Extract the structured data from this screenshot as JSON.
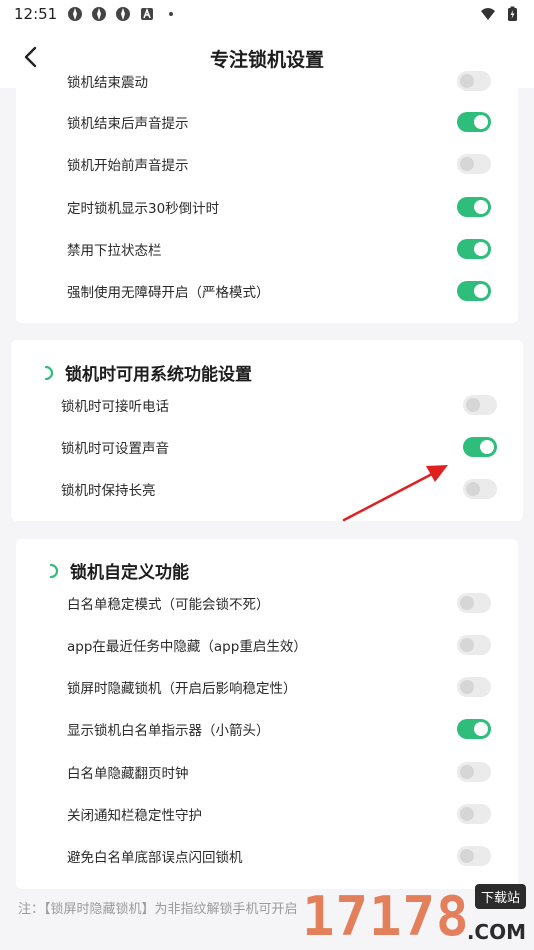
{
  "status_bar": {
    "time": "12:51",
    "left_icons": [
      "app-icon-1",
      "app-icon-2",
      "app-icon-3",
      "a-icon"
    ],
    "right_icons": [
      "wifi-icon",
      "battery-icon"
    ]
  },
  "header": {
    "title": "专注锁机设置"
  },
  "card1": {
    "rows": [
      {
        "label": "锁机结束震动",
        "on": false
      },
      {
        "label": "锁机结束后声音提示",
        "on": true
      },
      {
        "label": "锁机开始前声音提示",
        "on": false
      },
      {
        "label": "定时锁机显示30秒倒计时",
        "on": true
      },
      {
        "label": "禁用下拉状态栏",
        "on": true
      },
      {
        "label": "强制使用无障碍开启（严格模式）",
        "on": true
      }
    ]
  },
  "card2": {
    "title": "锁机时可用系统功能设置",
    "rows": [
      {
        "label": "锁机时可接听电话",
        "on": false
      },
      {
        "label": "锁机时可设置声音",
        "on": true
      },
      {
        "label": "锁机时保持长亮",
        "on": false
      }
    ]
  },
  "card3": {
    "title": "锁机自定义功能",
    "rows": [
      {
        "label": "白名单稳定模式（可能会锁不死）",
        "on": false
      },
      {
        "label": "app在最近任务中隐藏（app重启生效）",
        "on": false
      },
      {
        "label": "锁屏时隐藏锁机（开启后影响稳定性）",
        "on": false
      },
      {
        "label": "显示锁机白名单指示器（小箭头）",
        "on": true
      },
      {
        "label": "白名单隐藏翻页时钟",
        "on": false
      },
      {
        "label": "关闭通知栏稳定性守护",
        "on": false
      },
      {
        "label": "避免白名单底部误点闪回锁机",
        "on": false
      }
    ]
  },
  "note": "注：【锁屏时隐藏锁机】为非指纹解锁手机可开启",
  "watermark": {
    "number": "17178",
    "badge": "下载站",
    "suffix": ".COM"
  },
  "colors": {
    "accent": "#2ebd7a",
    "toggle_off": "#ebebeb",
    "arrow": "#e02020"
  }
}
